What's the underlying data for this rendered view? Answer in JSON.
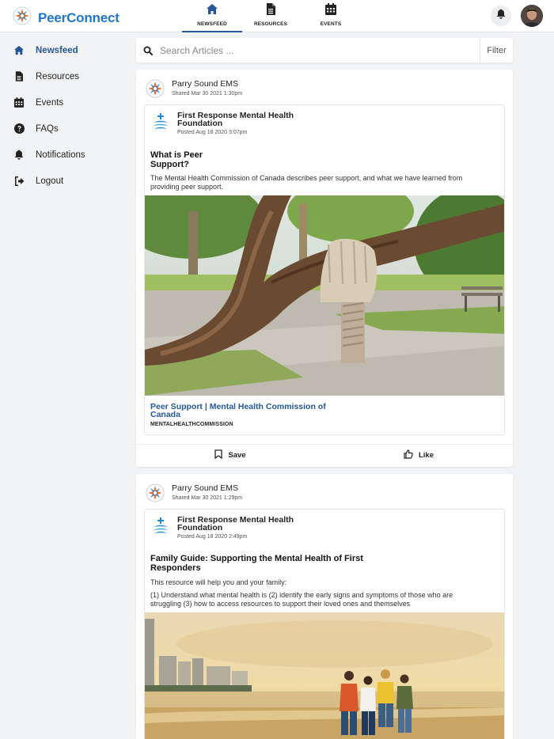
{
  "app": {
    "name": "PeerConnect"
  },
  "nav": {
    "tabs": [
      {
        "label": "NEWSFEED",
        "icon": "home-icon",
        "active": true
      },
      {
        "label": "RESOURCES",
        "icon": "document-icon",
        "active": false
      },
      {
        "label": "EVENTS",
        "icon": "calendar-icon",
        "active": false
      }
    ]
  },
  "sidebar": {
    "items": [
      {
        "label": "Newsfeed",
        "icon": "home-icon",
        "active": true
      },
      {
        "label": "Resources",
        "icon": "document-icon"
      },
      {
        "label": "Events",
        "icon": "calendar-icon"
      },
      {
        "label": "FAQs",
        "icon": "question-icon"
      },
      {
        "label": "Notifications",
        "icon": "bell-icon"
      },
      {
        "label": "Logout",
        "icon": "logout-icon"
      }
    ]
  },
  "search": {
    "placeholder": "Search Articles ...",
    "filter_label": "Filter"
  },
  "colors": {
    "brand": "#1f77c9",
    "accent": "#25579a"
  },
  "posts": [
    {
      "sharer": {
        "name": "Parry Sound EMS",
        "meta": "Shared Mar 30 2021 1:30pm"
      },
      "poster": {
        "name": "First Response Mental Health Foundation",
        "meta": "Posted Aug 18 2020 3:07pm"
      },
      "title": "What is Peer Support?",
      "description": "The Mental Health Commission of Canada describes peer support, and what we have learned from providing peer support.",
      "link_title": "Peer Support | Mental Health Commission of Canada",
      "link_source": "MENTALHEALTHCOMMISSION",
      "save_label": "Save",
      "like_label": "Like"
    },
    {
      "sharer": {
        "name": "Parry Sound EMS",
        "meta": "Shared Mar 30 2021 1:29pm"
      },
      "poster": {
        "name": "First Response Mental Health Foundation",
        "meta": "Posted Aug 18 2020 2:49pm"
      },
      "title": "Family Guide: Supporting the Mental Health of First Responders",
      "description_1": "This resource will help you and your family:",
      "description_2": "(1) Understand what mental health is (2) identify the early signs and symptoms of those who are struggling (3) how to access resources to support their loved ones and themselves"
    }
  ]
}
